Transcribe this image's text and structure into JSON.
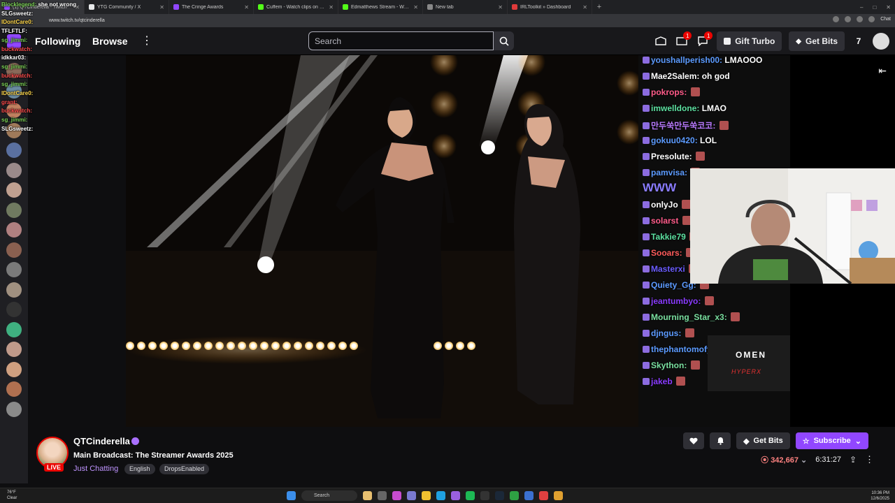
{
  "browser": {
    "tabs": [
      {
        "title": "(1) QTCinderella - Twitch",
        "active": true,
        "color": "#9147ff"
      },
      {
        "title": "YTG Community / X",
        "active": false,
        "color": "#e7e9ea"
      },
      {
        "title": "The Cringe Awards",
        "active": false,
        "color": "#9147ff"
      },
      {
        "title": "Cuffem - Watch clips on Kick",
        "active": false,
        "color": "#53fc18"
      },
      {
        "title": "Edmatthews Stream - Watch Live o",
        "active": false,
        "color": "#53fc18"
      },
      {
        "title": "New tab",
        "active": false,
        "color": "#888888"
      },
      {
        "title": "IRLToolkit » Dashboard",
        "active": false,
        "color": "#e03a3a"
      }
    ],
    "url": "www.twitch.tv/qtcinderella",
    "chat_button": "Chat"
  },
  "topnav": {
    "following": "Following",
    "browse": "Browse",
    "search_placeholder": "Search",
    "notif_badge_1": "1",
    "notif_badge_2": "1",
    "gift_turbo": "Gift Turbo",
    "get_bits": "Get Bits"
  },
  "overlay_chat": [
    {
      "user": "Blocklegend:",
      "msg": "she not wrong",
      "color": "#7cd157"
    },
    {
      "user": "SLGsweetz:",
      "msg": "",
      "color": "#ffffff"
    },
    {
      "user": "IDontCare0:",
      "msg": "",
      "color": "#ffd84d"
    },
    {
      "user": "TFLFTLF:",
      "msg": "",
      "color": "#ffffff"
    },
    {
      "user": "sg_jimmi:",
      "msg": "",
      "color": "#7cd157"
    },
    {
      "user": "buckwatch:",
      "msg": "",
      "color": "#ff4d4d"
    },
    {
      "user": "idkkar03:",
      "msg": "",
      "color": "#ffffff"
    },
    {
      "user": "sg_jimmi:",
      "msg": "",
      "color": "#7cd157"
    },
    {
      "user": "buckwatch:",
      "msg": "",
      "color": "#ff4d4d"
    },
    {
      "user": "sg_jimmi:",
      "msg": "",
      "color": "#7cd157"
    },
    {
      "user": "IDontCare0:",
      "msg": "",
      "color": "#ffd84d"
    },
    {
      "user": "grant:",
      "msg": "",
      "color": "#ff4d4d"
    },
    {
      "user": "buckwatch:",
      "msg": "",
      "color": "#ff4d4d"
    },
    {
      "user": "sg_jimmi:",
      "msg": "",
      "color": "#7cd157"
    },
    {
      "user": "SLGsweetz:",
      "msg": "",
      "color": "#ffffff"
    }
  ],
  "stream_chat": [
    {
      "user": "youshallperish00:",
      "msg": "LMAOOO",
      "color": "#5c9bff"
    },
    {
      "user": "Mae2Salem:",
      "msg": "oh god",
      "color": "#ffffff"
    },
    {
      "user": "pokrops:",
      "msg": "",
      "color": "#ff5c8a"
    },
    {
      "user": "imwelldone:",
      "msg": "LMAO",
      "color": "#5ce0a0"
    },
    {
      "user": "만두쑥만두쑥코코:",
      "msg": "",
      "color": "#b97aff"
    },
    {
      "user": "gokuu0420:",
      "msg": "LOL",
      "color": "#5c9bff"
    },
    {
      "user": "Presolute:",
      "msg": "",
      "color": "#ffffff"
    },
    {
      "user": "pamvisa:",
      "msg": "",
      "color": "#5c9bff"
    },
    {
      "user": "WWW",
      "msg": "",
      "color": "#8a7cff"
    },
    {
      "user": "onlyJo",
      "msg": "",
      "color": "#ffffff"
    },
    {
      "user": "solarst",
      "msg": "",
      "color": "#ff5c8a"
    },
    {
      "user": "Takkie79",
      "msg": "",
      "color": "#5ce0a0"
    },
    {
      "user": "Sooars:",
      "msg": "",
      "color": "#ff5c5c"
    },
    {
      "user": "Masterxi",
      "msg": "",
      "color": "#6a5cff"
    },
    {
      "user": "Quiety_Gg:",
      "msg": "",
      "color": "#5c9bff"
    },
    {
      "user": "jeantumbyo:",
      "msg": "",
      "color": "#8a3cff"
    },
    {
      "user": "Mourning_Star_x3:",
      "msg": "",
      "color": "#7ae0a0"
    },
    {
      "user": "djngus:",
      "msg": "",
      "color": "#5c9bff"
    },
    {
      "user": "thephantomofy",
      "msg": "",
      "color": "#5c9bff"
    },
    {
      "user": "Skython:",
      "msg": "",
      "color": "#7ae0a0"
    },
    {
      "user": "jakeb",
      "msg": "",
      "color": "#8a3cff"
    }
  ],
  "sponsor": {
    "line1": "OMEN",
    "line2": "HYPERX"
  },
  "channel": {
    "name": "QTCinderella",
    "live": "LIVE",
    "title": "Main Broadcast: The Streamer Awards 2025",
    "category": "Just Chatting",
    "tags": [
      "English",
      "DropsEnabled"
    ],
    "get_bits": "Get Bits",
    "subscribe": "Subscribe",
    "viewers": "342,667",
    "uptime": "6:31:27"
  },
  "taskbar": {
    "weather_temp": "76°F",
    "weather_desc": "Clear",
    "search": "Search",
    "time": "10:36 PM",
    "date": "12/6/2025"
  },
  "colors": {
    "twitch_purple": "#9147ff",
    "live_red": "#eb0400",
    "viewer_red": "#ff8280"
  }
}
